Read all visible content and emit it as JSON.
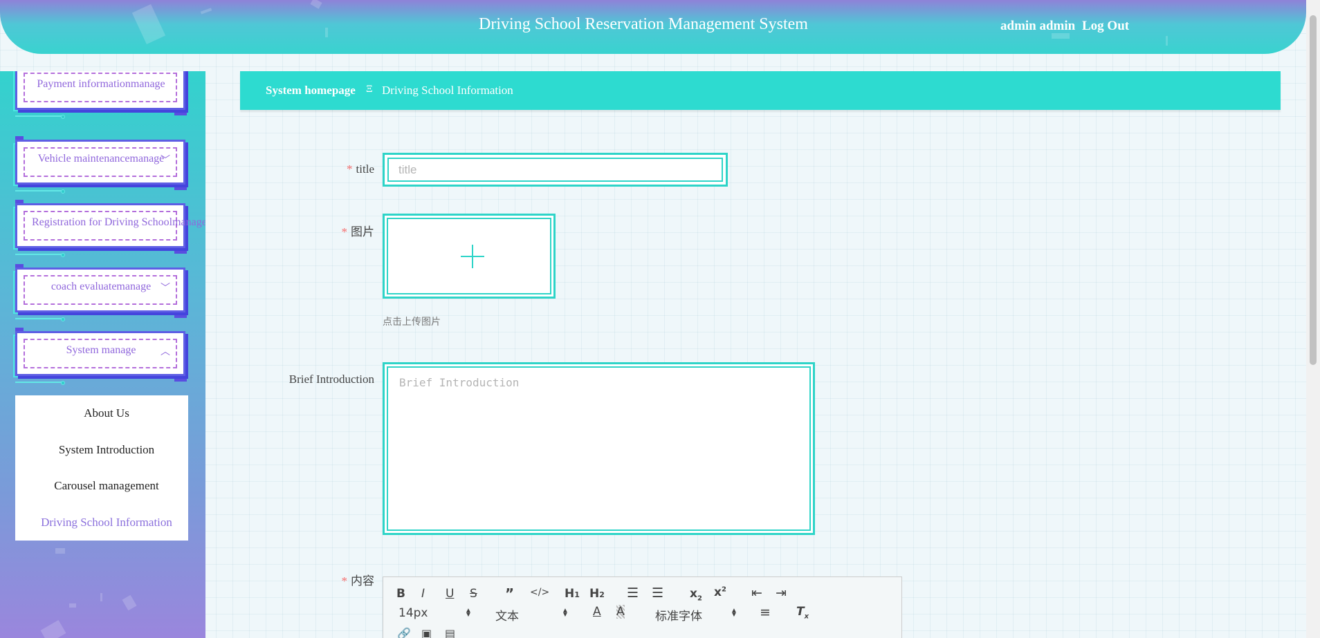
{
  "header": {
    "title": "Driving School Reservation Management System",
    "user": "admin admin",
    "logout": "Log Out"
  },
  "sidebar": {
    "items": [
      {
        "label": "Payment informationmanage"
      },
      {
        "label": "Vehicle maintenancemanage"
      },
      {
        "label": "Registration for Driving Schoolmanage"
      },
      {
        "label": "coach evaluatemanage"
      },
      {
        "label": "System manage"
      }
    ],
    "submenu": [
      {
        "label": "About Us"
      },
      {
        "label": "System Introduction"
      },
      {
        "label": "Carousel management"
      },
      {
        "label": "Driving School Information"
      }
    ]
  },
  "breadcrumb": {
    "home": "System homepage",
    "separator": "Ξ",
    "current": "Driving School Information"
  },
  "form": {
    "title": {
      "label": "title",
      "placeholder": "title",
      "value": ""
    },
    "picture": {
      "label": "图片",
      "hint": "点击上传图片"
    },
    "intro": {
      "label": "Brief Introduction",
      "placeholder": "Brief Introduction",
      "value": ""
    },
    "content": {
      "label": "内容"
    }
  },
  "editor": {
    "font_size": "14px",
    "text_style": "文本",
    "font_family": "标准字体"
  },
  "colors": {
    "accent": "#2ddbd0",
    "menu_text": "#9067dc",
    "required": "#f56c6c"
  }
}
